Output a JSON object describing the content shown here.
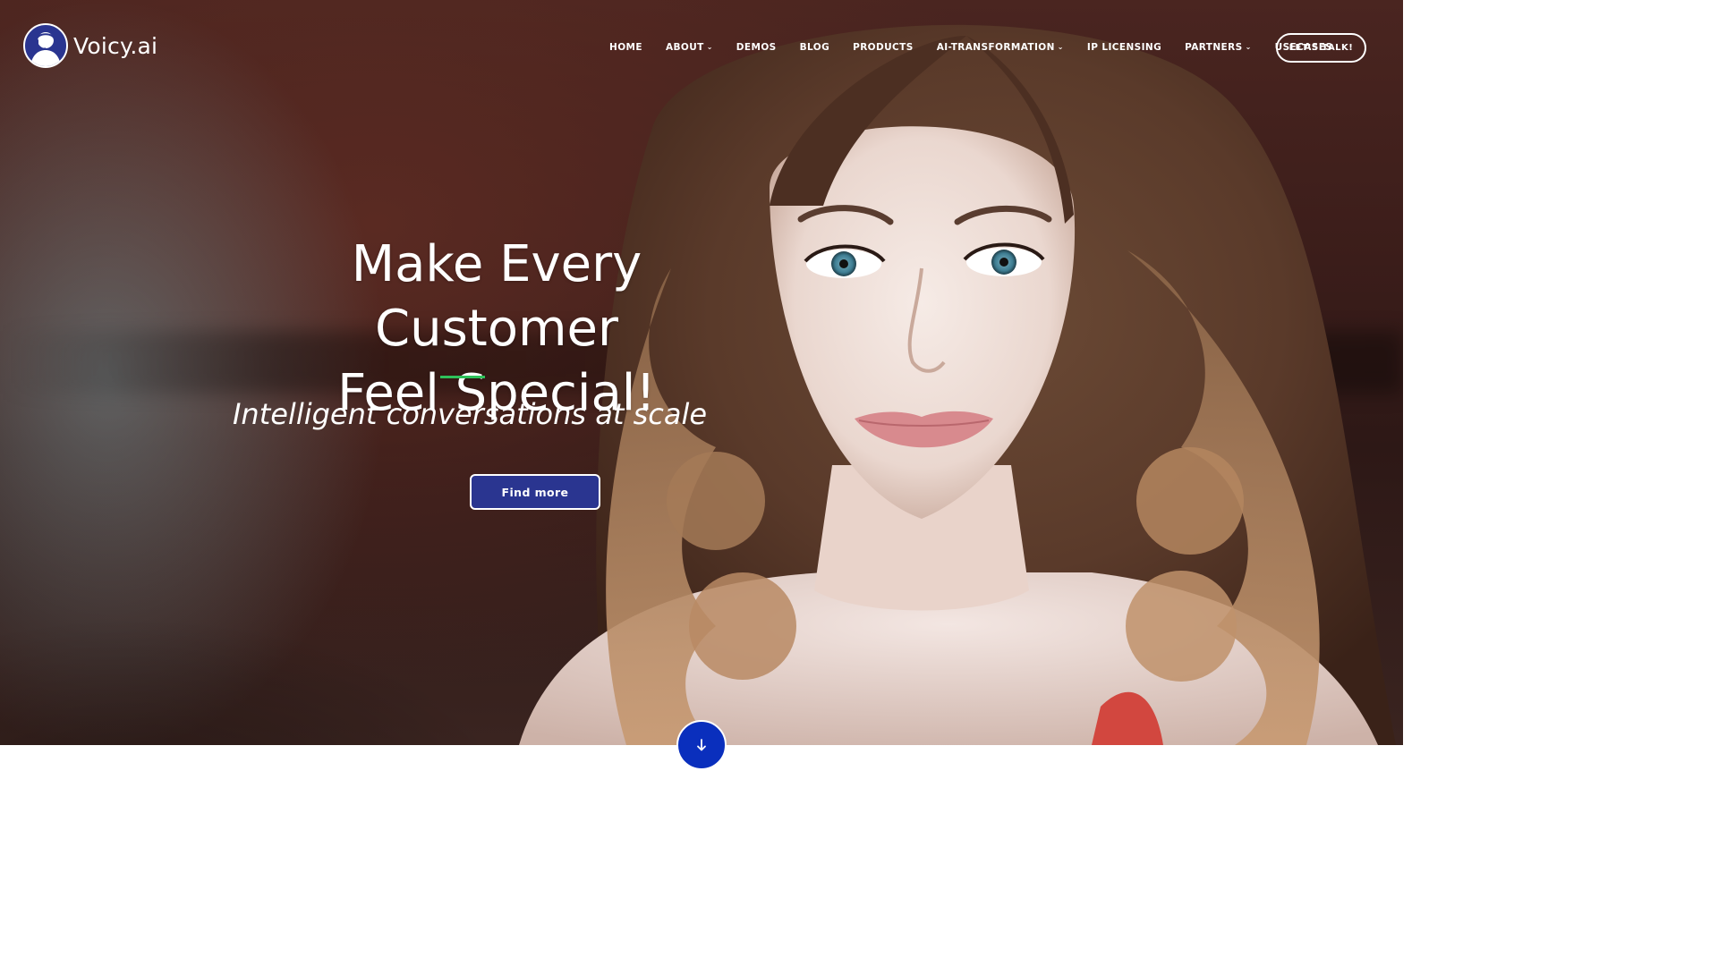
{
  "brand": {
    "name": "Voicy.ai",
    "logo_icon": "headset-person-icon"
  },
  "nav": {
    "items": [
      {
        "label": "HOME",
        "dropdown": false
      },
      {
        "label": "ABOUT",
        "dropdown": true
      },
      {
        "label": "DEMOS",
        "dropdown": false
      },
      {
        "label": "BLOG",
        "dropdown": false
      },
      {
        "label": "PRODUCTS",
        "dropdown": false
      },
      {
        "label": "AI-TRANSFORMATION",
        "dropdown": true
      },
      {
        "label": "IP LICENSING",
        "dropdown": false
      },
      {
        "label": "PARTNERS",
        "dropdown": true
      },
      {
        "label": "USECASES",
        "dropdown": false
      }
    ],
    "cta_label": "LET'S TALK!"
  },
  "hero": {
    "headline_line1": "Make Every Customer",
    "headline_line2": "Feel Special!",
    "tagline": "Intelligent conversations at scale",
    "button_label": "Find more",
    "scroll_icon": "arrow-down-icon"
  },
  "colors": {
    "accent_green": "#2ec15a",
    "brand_blue": "#2a3590",
    "scroll_blue": "#0a2fbd"
  }
}
